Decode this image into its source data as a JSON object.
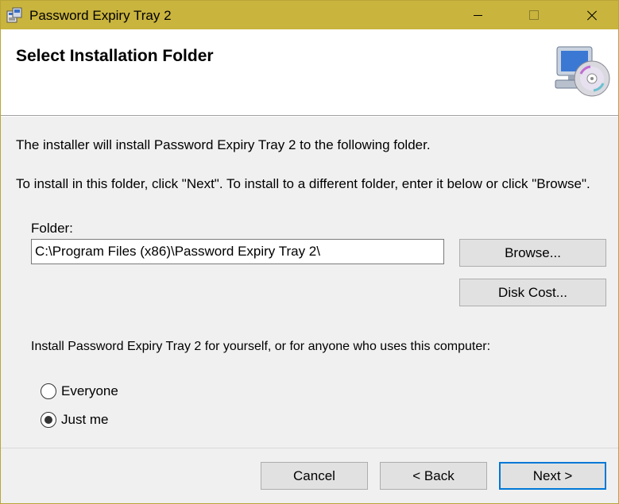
{
  "window": {
    "title": "Password Expiry Tray 2"
  },
  "header": {
    "heading": "Select Installation Folder"
  },
  "body": {
    "intro": "The installer will install Password Expiry Tray 2 to the following folder.",
    "instructions": "To install in this folder, click \"Next\". To install to a different folder, enter it below or click \"Browse\".",
    "folder_label": "Folder:",
    "folder_value": "C:\\Program Files (x86)\\Password Expiry Tray 2\\",
    "browse_label": "Browse...",
    "disk_cost_label": "Disk Cost...",
    "install_for_prompt": "Install Password Expiry Tray 2 for yourself, or for anyone who uses this computer:",
    "options": [
      {
        "label": "Everyone",
        "selected": false
      },
      {
        "label": "Just me",
        "selected": true
      }
    ]
  },
  "footer": {
    "cancel_label": "Cancel",
    "back_label": "< Back",
    "next_label": "Next >"
  },
  "colors": {
    "titlebar": "#c9b43e",
    "accent": "#0078d7"
  }
}
